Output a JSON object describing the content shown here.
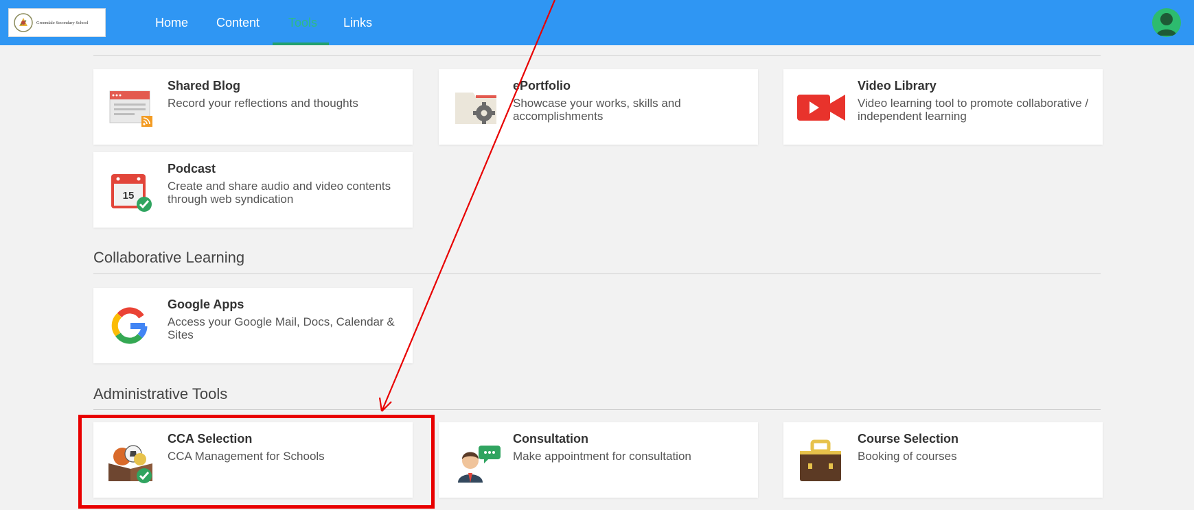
{
  "school": {
    "name": "Greendale Secondary School"
  },
  "nav": {
    "items": [
      {
        "label": "Home"
      },
      {
        "label": "Content"
      },
      {
        "label": "Tools",
        "active": true
      },
      {
        "label": "Links"
      }
    ]
  },
  "user": {
    "avatar_icon": "user-avatar-icon"
  },
  "sections": [
    {
      "heading": ""
    },
    {
      "heading": "Collaborative Learning"
    },
    {
      "heading": "Administrative Tools"
    }
  ],
  "tools": {
    "shared_blog": {
      "title": "Shared Blog",
      "description": "Record your reflections and thoughts",
      "icon": "blog-browser-rss-icon"
    },
    "eportfolio": {
      "title": "ePortfolio",
      "description": "Showcase your works, skills and accomplishments",
      "icon": "folder-gear-icon"
    },
    "video_library": {
      "title": "Video Library",
      "description": "Video learning tool to promote collaborative / independent learning",
      "icon": "video-camera-icon"
    },
    "podcast": {
      "title": "Podcast",
      "description": "Create and share audio and video contents through web syndication",
      "icon": "calendar-check-icon",
      "calendar_day": "15"
    },
    "google_apps": {
      "title": "Google Apps",
      "description": "Access your Google Mail, Docs, Calendar & Sites",
      "icon": "google-g-icon"
    },
    "cca_selection": {
      "title": "CCA Selection",
      "description": "CCA Management for Schools",
      "icon": "sports-box-check-icon"
    },
    "consultation": {
      "title": "Consultation",
      "description": "Make appointment for consultation",
      "icon": "person-speech-icon"
    },
    "course_selection": {
      "title": "Course Selection",
      "description": "Booking of courses",
      "icon": "briefcase-icon"
    }
  },
  "colors": {
    "navbar": "#2f96f3",
    "active_nav": "#2dbb87",
    "annotation": "#e80000",
    "page_background": "#f2f2f2"
  },
  "annotation": {
    "type": "red-box-with-arrow",
    "target": "CCA Selection"
  }
}
